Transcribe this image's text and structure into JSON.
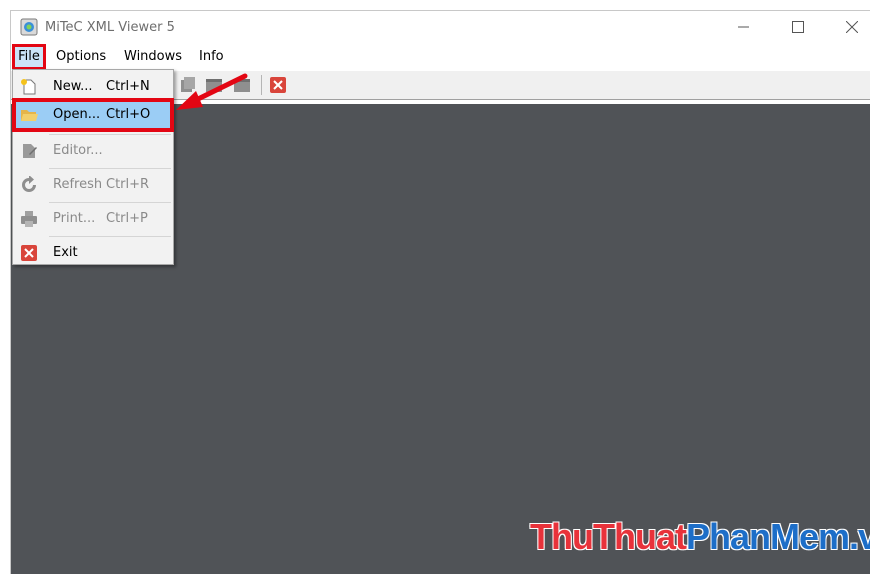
{
  "window": {
    "title": "MiTeC XML Viewer 5",
    "controls": {
      "minimize": "—",
      "maximize": "☐",
      "close": "✕"
    }
  },
  "menubar": {
    "items": [
      "File",
      "Options",
      "Windows",
      "Info"
    ]
  },
  "file_menu": {
    "items": [
      {
        "label": "New...",
        "shortcut": "Ctrl+N",
        "enabled": true,
        "icon": "new-file-icon"
      },
      {
        "label": "Open...",
        "shortcut": "Ctrl+O",
        "enabled": true,
        "highlighted": true,
        "icon": "open-folder-icon"
      },
      {
        "label": "Editor...",
        "shortcut": "",
        "enabled": false,
        "icon": "editor-icon"
      },
      {
        "label": "Refresh",
        "shortcut": "Ctrl+R",
        "enabled": false,
        "icon": "refresh-icon"
      },
      {
        "label": "Print...",
        "shortcut": "Ctrl+P",
        "enabled": false,
        "icon": "printer-icon"
      },
      {
        "label": "Exit",
        "shortcut": "",
        "enabled": true,
        "icon": "exit-icon"
      }
    ]
  },
  "watermark": {
    "part1": "ThuThuat",
    "part2": "PhanMem",
    "part3": ".vn"
  },
  "colors": {
    "highlight_border": "#e30613",
    "workspace": "#505357",
    "selection": "#9bcdf5"
  }
}
